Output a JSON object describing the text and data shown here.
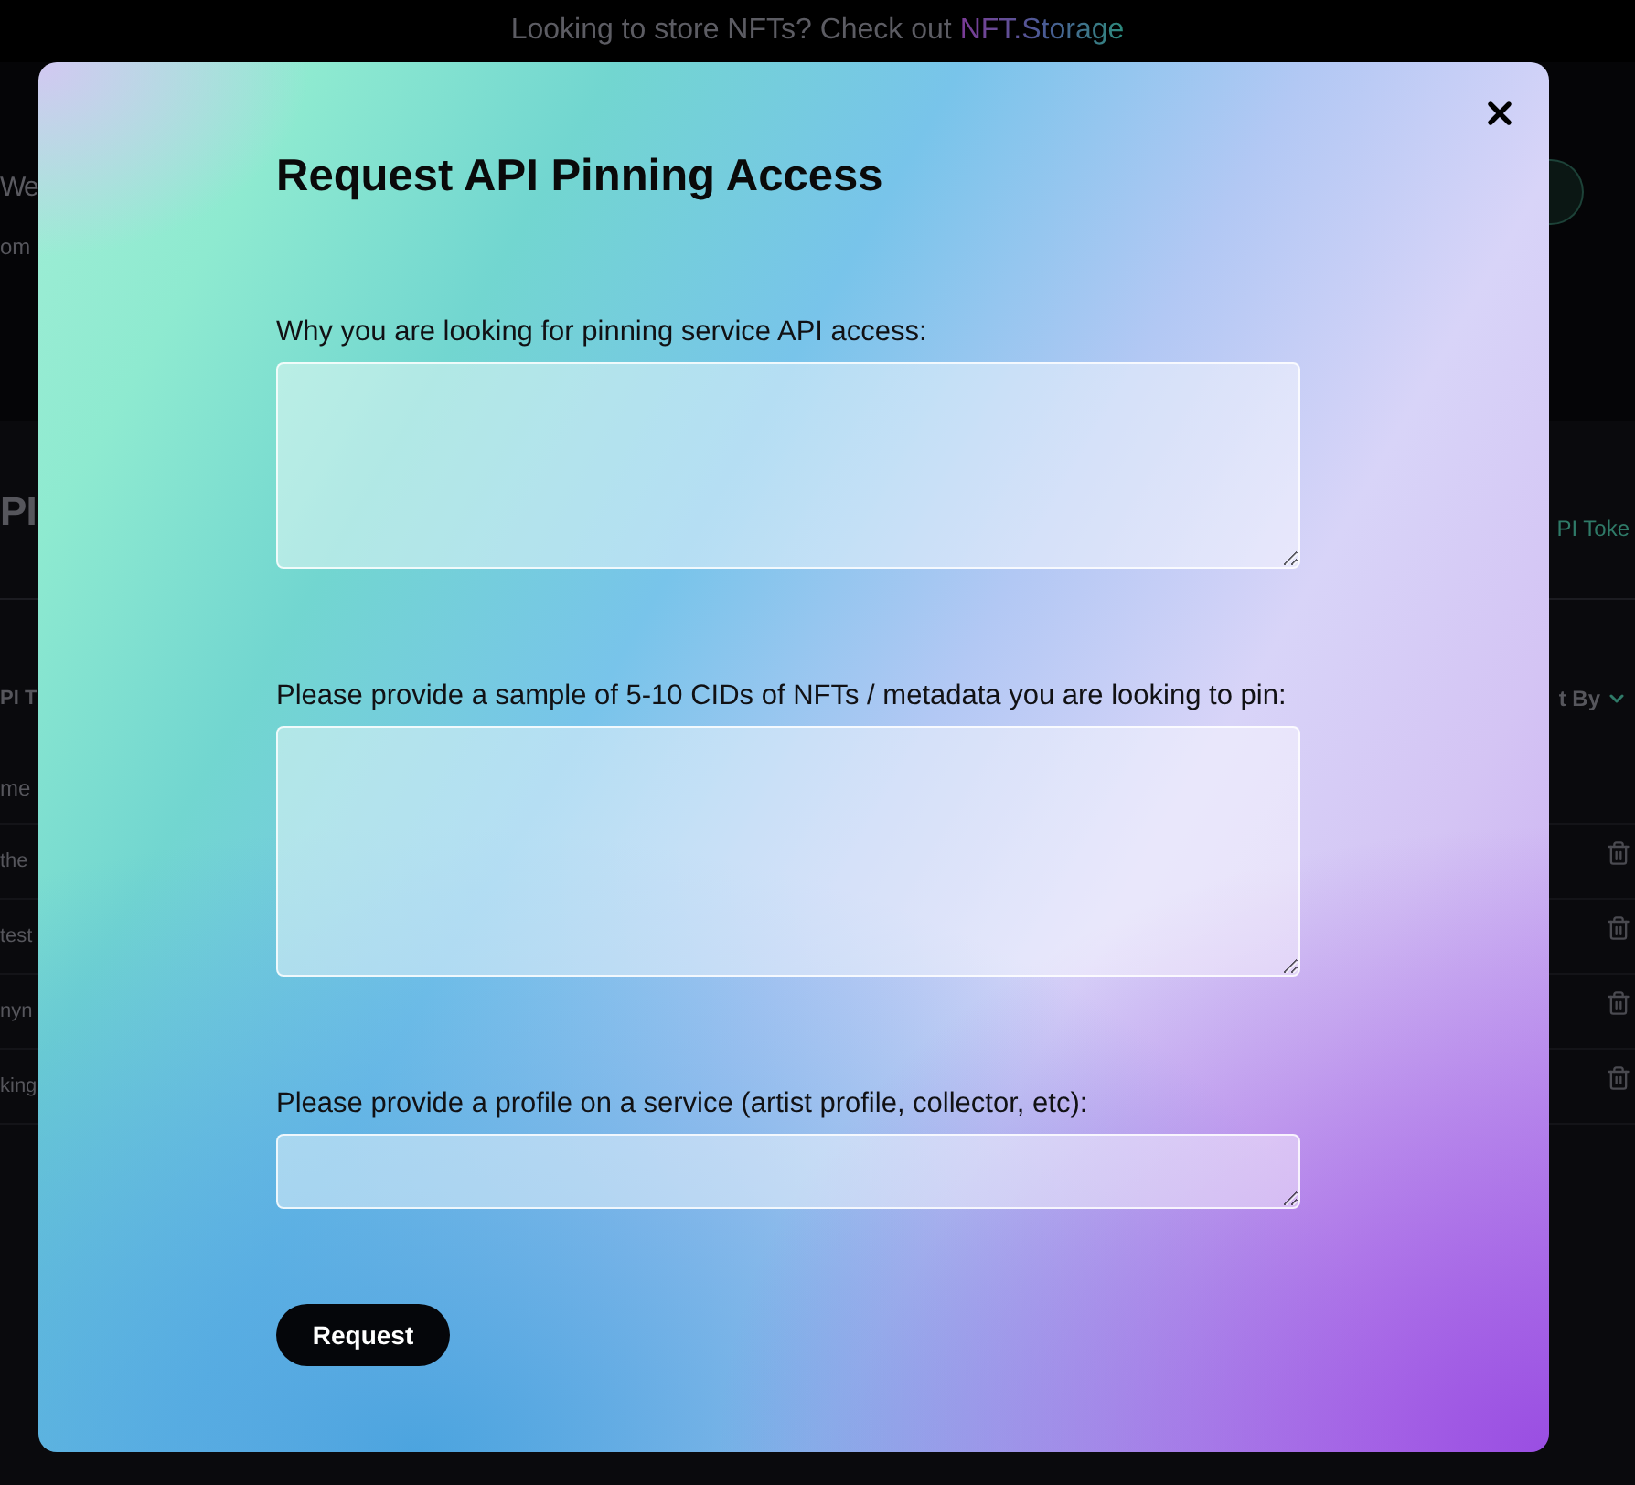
{
  "banner": {
    "text": "Looking to store NFTs? Check out",
    "link": "NFT.Storage"
  },
  "page": {
    "heading": "We",
    "subheading": "om",
    "section_title": "PI",
    "section_link": "PI Toke",
    "table_title": "PI T",
    "sort_label": "t By",
    "table": {
      "column_1": "me",
      "rows": [
        {
          "column_1": "the"
        },
        {
          "column_1": "test"
        },
        {
          "column_1": "nyn"
        },
        {
          "column_1": "king"
        }
      ]
    }
  },
  "modal": {
    "title": "Request API Pinning Access",
    "fields": [
      {
        "label": "Why you are looking for pinning service API access:"
      },
      {
        "label": "Please provide a sample of 5-10 CIDs of NFTs / metadata you are looking to pin:"
      },
      {
        "label": "Please provide a profile on a service (artist profile, collector, etc):"
      }
    ],
    "submit_button": "Request"
  }
}
